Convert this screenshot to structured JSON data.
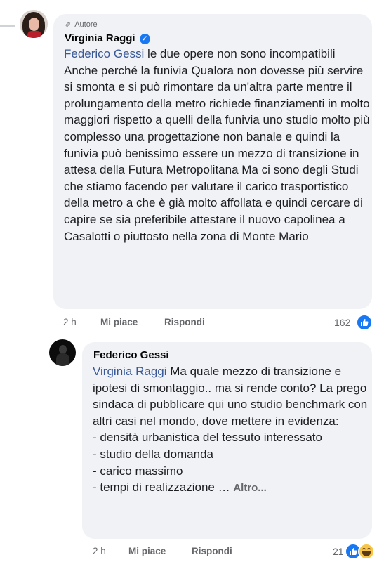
{
  "comment": {
    "author_badge": "Autore",
    "author_name": "Virginia Raggi",
    "mention": "Federico Gessi",
    "text": " le due opere non sono incompatibili Anche perché la funivia Qualora non dovesse più servire si smonta e si può rimontare da un'altra parte mentre il prolungamento della metro richiede finanziamenti in molto maggiori rispetto a quelli della funivia uno studio molto più complesso una progettazione non banale e quindi la funivia può benissimo essere un mezzo di transizione in attesa della Futura Metropolitana Ma ci sono degli Studi che stiamo facendo per valutare il carico trasportistico della metro a che è già molto affollata e quindi cercare di capire se sia preferibile attestare il nuovo capolinea a Casalotti o piuttosto nella zona di Monte Mario",
    "time": "2 h",
    "like_label": "Mi piace",
    "reply_label": "Rispondi",
    "reaction_count": "162",
    "reaction_icons": [
      "like-icon"
    ],
    "colors": {
      "mention": "#385898",
      "verified": "#1877f2",
      "bubble": "#f0f2f5"
    }
  },
  "reply": {
    "author_name": "Federico Gessi",
    "mention": "Virginia Raggi",
    "text": " Ma quale mezzo di transizione e ipotesi di smontaggio.. ma si rende conto? La prego sindaca di pubblicare qui uno studio benchmark con altri casi nel mondo, dove mettere in evidenza:\n- densità urbanistica del tessuto interessato\n- studio della domanda\n- carico massimo\n- tempi di realizzazione … ",
    "see_more": "Altro...",
    "time": "2 h",
    "like_label": "Mi piace",
    "reply_label": "Rispondi",
    "reaction_count": "21",
    "reaction_icons": [
      "like-icon",
      "haha-icon"
    ]
  }
}
